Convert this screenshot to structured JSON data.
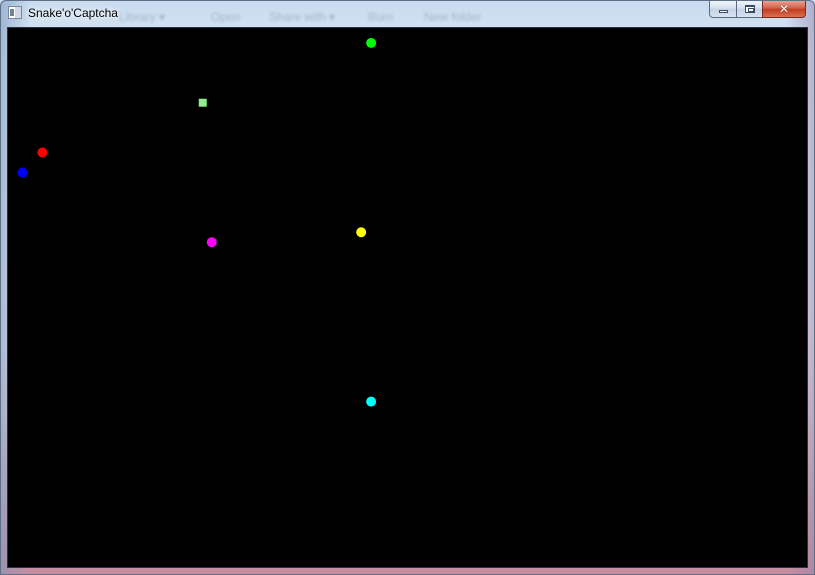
{
  "window": {
    "title": "Snake'o'Captcha"
  },
  "background_menu_ghost": [
    "Library ▾",
    "Open",
    "Share with ▾",
    "Burn",
    "New folder"
  ],
  "icons": {
    "app": "window-app-icon",
    "minimize": "minimize-icon",
    "maximize": "maximize-icon",
    "close": "close-icon"
  },
  "game": {
    "background_color": "#000000",
    "food": {
      "color": "#90ee90"
    },
    "dots": [
      {
        "name": "dot-green",
        "color": "#00ff00"
      },
      {
        "name": "dot-red",
        "color": "#ff0000"
      },
      {
        "name": "dot-blue",
        "color": "#0000ff"
      },
      {
        "name": "dot-magenta",
        "color": "#ff00ff"
      },
      {
        "name": "dot-yellow",
        "color": "#ffff00"
      },
      {
        "name": "dot-cyan",
        "color": "#00ffff"
      }
    ]
  }
}
